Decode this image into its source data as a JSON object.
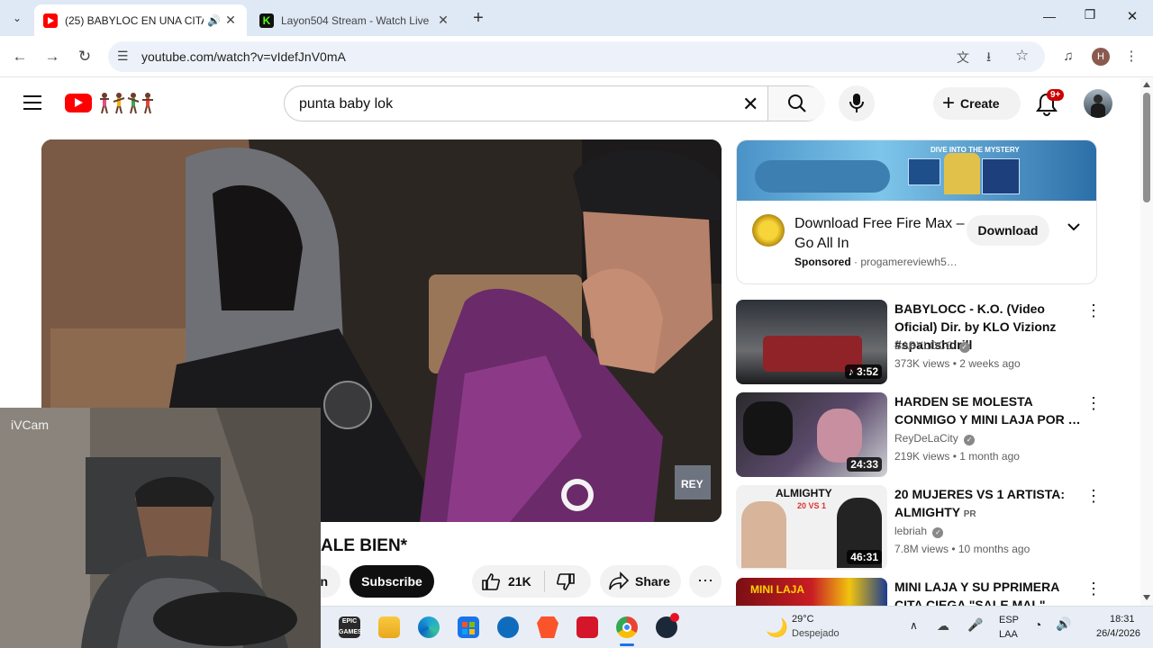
{
  "browser": {
    "tabs": [
      {
        "title": "(25) BABYLOC EN UNA CITA",
        "audio_icon": "speaker-icon"
      },
      {
        "title": "Layon504 Stream - Watch Live"
      }
    ],
    "url": "youtube.com/watch?v=vIdefJnV0mA",
    "profile_initial": "H"
  },
  "youtube": {
    "search_query": "punta baby lok",
    "create_label": "Create",
    "notifications_badge": "9+"
  },
  "ad": {
    "title": "Download Free Fire Max – Go All In",
    "sponsored_label": "Sponsored",
    "advertiser": "progamereviewh5…",
    "button_label": "Download",
    "banner_text": "DIVE INTO THE MYSTERY"
  },
  "recommendations": [
    {
      "title": "BABYLOCC - K.O. (Video Oficial) Dir. by KLO Vizionz #spanishdrill",
      "channel": "BABYLOCC",
      "verified": true,
      "meta": "373K views • 2 weeks ago",
      "duration": "3:52",
      "music": true
    },
    {
      "title": "HARDEN SE MOLESTA CONMIGO Y MINI LAJA POR …",
      "channel": "ReyDeLaCity",
      "verified": true,
      "meta": "219K views • 1 month ago",
      "duration": "24:33"
    },
    {
      "title": "20 MUJERES VS 1 ARTISTA: ALMIGHTY",
      "title_suffix": "PR",
      "channel": "lebriah",
      "verified": true,
      "meta": "7.8M views • 10 months ago",
      "duration": "46:31",
      "thumb_text": "ALMIGHTY",
      "thumb_sub": "20 VS 1"
    },
    {
      "title": "MINI LAJA Y SU PPRIMERA CITA CIEGA \"SALE MAL\"",
      "thumb_text": "MINI LAJA"
    }
  ],
  "video": {
    "title_visible": "ALE BIEN*",
    "subscribe_label": "Subscribe",
    "partial_button": "n",
    "likes": "21K",
    "share_label": "Share",
    "watermark": "REY"
  },
  "webcam": {
    "label": "iVCam"
  },
  "taskbar": {
    "weather_temp": "29°C",
    "weather_desc": "Despejado",
    "lang_line1": "ESP",
    "lang_line2": "LAA",
    "time": "18:31",
    "date": "26/4/2026"
  },
  "colors": {
    "yt_red": "#ff0000",
    "chrome_tabbar": "#dfe8f5",
    "omnibox": "#edf2fa"
  }
}
